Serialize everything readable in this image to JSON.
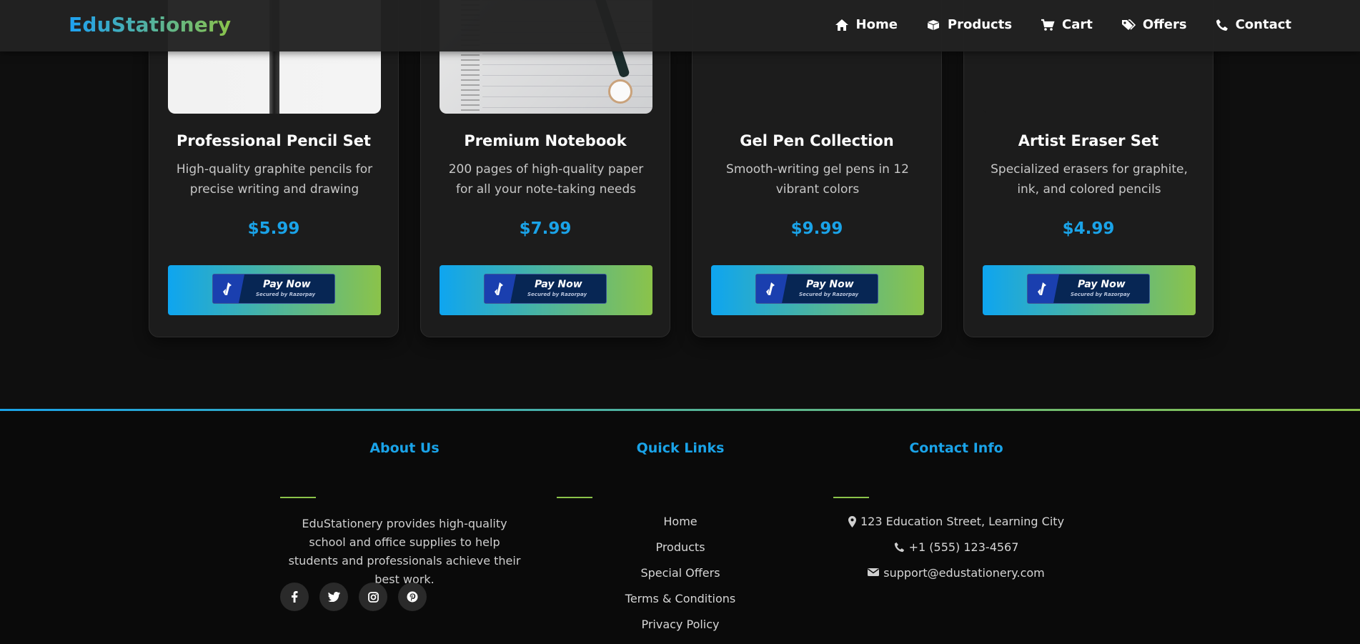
{
  "brand": {
    "name": "EduStationery"
  },
  "nav": {
    "items": [
      {
        "label": "Home",
        "icon": "home-icon"
      },
      {
        "label": "Products",
        "icon": "box-icon"
      },
      {
        "label": "Cart",
        "icon": "cart-icon"
      },
      {
        "label": "Offers",
        "icon": "tags-icon"
      },
      {
        "label": "Contact",
        "icon": "phone-icon"
      }
    ]
  },
  "products": [
    {
      "title": "Professional Pencil Set",
      "desc": "High-quality graphite pencils for precise writing and drawing",
      "price": "$5.99"
    },
    {
      "title": "Premium Notebook",
      "desc": "200 pages of high-quality paper for all your note-taking needs",
      "price": "$7.99"
    },
    {
      "title": "Gel Pen Collection",
      "desc": "Smooth-writing gel pens in 12 vibrant colors",
      "price": "$9.99"
    },
    {
      "title": "Artist Eraser Set",
      "desc": "Specialized erasers for graphite, ink, and colored pencils",
      "price": "$4.99"
    }
  ],
  "pay": {
    "label": "Pay Now",
    "secured": "Secured by Razorpay"
  },
  "footer": {
    "about": {
      "title": "About Us",
      "text": "EduStationery provides high-quality school and office supplies to help students and professionals achieve their best work.",
      "socials": [
        "facebook-icon",
        "twitter-icon",
        "instagram-icon",
        "pinterest-icon"
      ]
    },
    "quick": {
      "title": "Quick Links",
      "links": [
        "Home",
        "Products",
        "Special Offers",
        "Terms & Conditions",
        "Privacy Policy"
      ]
    },
    "contact": {
      "title": "Contact Info",
      "address": "123 Education Street, Learning City",
      "phone": "+1 (555) 123-4567",
      "email": "support@edustationery.com"
    }
  },
  "colors": {
    "accent_blue": "#1aa3e8",
    "accent_green": "#8bc34a",
    "background": "#0f0f0f"
  }
}
